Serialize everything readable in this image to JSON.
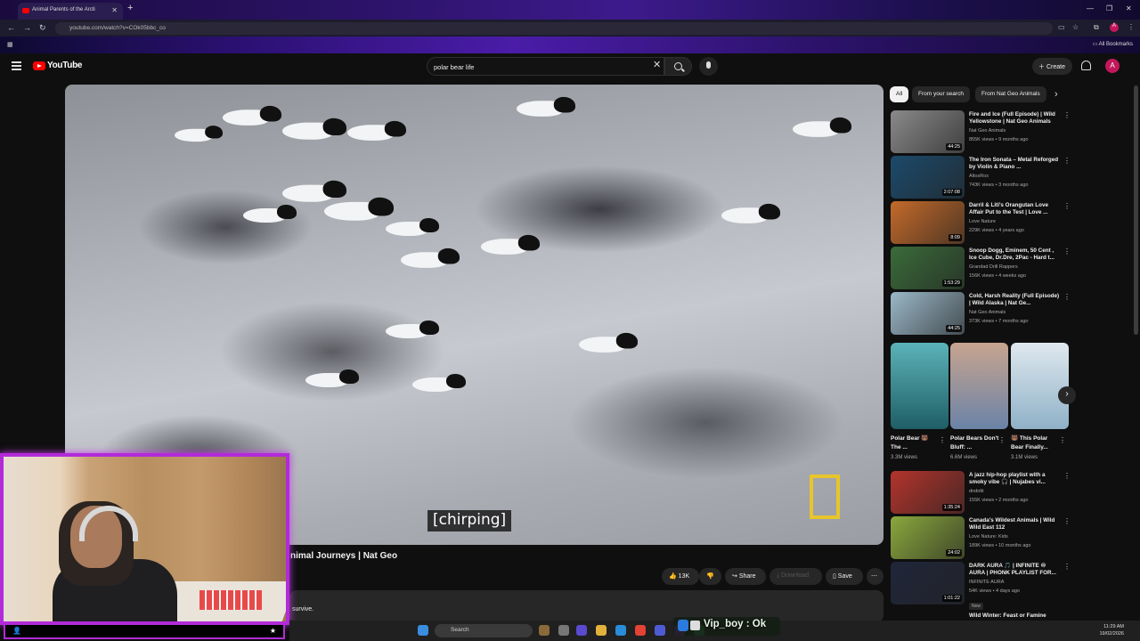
{
  "browser": {
    "tab_title": "Animal Parents of the Arcti",
    "url": "youtube.com/watch?v=COk05bbc_co",
    "all_bookmarks": "All Bookmarks"
  },
  "header": {
    "brand": "YouTube",
    "search_query": "polar bear life",
    "create_label": "Create",
    "avatar_letter": "A"
  },
  "player": {
    "caption": "[chirping]"
  },
  "video": {
    "title": "nimal Journeys | Nat Geo",
    "likes": "13K",
    "share_label": "Share",
    "download_label": "Download",
    "save_label": "Save",
    "description_snippet": "survive."
  },
  "chips": [
    "All",
    "From your search",
    "From Nat Geo Animals"
  ],
  "recommendations": [
    {
      "title": "Fire and Ice (Full Episode) | Wild Yellowstone | Nat Geo Animals",
      "channel": "Nat Geo Animals",
      "meta": "855K views • 9 months ago",
      "duration": "44:25",
      "thumb_color": "#8a8a8a"
    },
    {
      "title": "The Iron Sonata – Metal Reforged by Violin & Piano ...",
      "channel": "AltosRox",
      "meta": "743K views • 3 months ago",
      "duration": "2:07:08",
      "thumb_color": "#1c4a6b"
    },
    {
      "title": "Darril & Liti's Orangutan Love Affair Put to the Test | Love ...",
      "channel": "Love Nature",
      "meta": "229K views • 4 years ago",
      "duration": "8:09",
      "thumb_color": "#c46a2a"
    },
    {
      "title": "Snoop Dogg, Eminem, 50 Cent , Ice Cube, Dr.Dre, 2Pac - Hard t...",
      "channel": "Grandad Drill Rappers",
      "meta": "156K views • 4 weeks ago",
      "duration": "1:53:29",
      "thumb_color": "#3a6b3a"
    },
    {
      "title": "Cold, Harsh Reality (Full Episode) | Wild Alaska | Nat Ge...",
      "channel": "Nat Geo Animals",
      "meta": "373K views • 7 months ago",
      "duration": "44:25",
      "thumb_color": "#9bb8c8"
    }
  ],
  "shorts": [
    {
      "title": "Polar Bear 🐻 The ...",
      "views": "3.3M views",
      "thumb_color": "#3d8a93"
    },
    {
      "title": "Polar Bears Don't Bluff: ...",
      "views": "6.6M views",
      "thumb_color": "#a47f6e"
    },
    {
      "title": "🐻 This Polar Bear Finally...",
      "views": "3.1M views",
      "thumb_color": "#9fb5c7"
    }
  ],
  "recommendations2": [
    {
      "title": "A jazz hip-hop playlist with a smoky vibe 🎧 | Nujabes vi...",
      "channel": "dndotti",
      "meta": "155K views • 2 months ago",
      "duration": "1:35:24",
      "thumb_color": "#b3342c"
    },
    {
      "title": "Canada's Wildest Animals | Wild Wild East 112",
      "channel": "Love Nature: Kids",
      "meta": "189K views • 10 months ago",
      "duration": "24:02",
      "thumb_color": "#8aa83d"
    },
    {
      "title": "DARK AURA 🎵 | INFINITE ♾ AURA | PHONK PLAYLIST FOR...",
      "channel": "INFINITE AURA",
      "meta": "54K views • 4 days ago",
      "duration": "1:01:22",
      "thumb_color": "#20263a"
    }
  ],
  "recommendations2_new": "New",
  "partial_next": "Wild Winter: Feast or Famine",
  "overlay": {
    "chat_message": "Vip_boy : Ok"
  },
  "taskbar": {
    "search_label": "Search",
    "time": "11:29 AM",
    "date": "19/02/2026"
  },
  "colors": {
    "accent_purple": "#b12bd8",
    "youtube_red": "#ff0000"
  }
}
